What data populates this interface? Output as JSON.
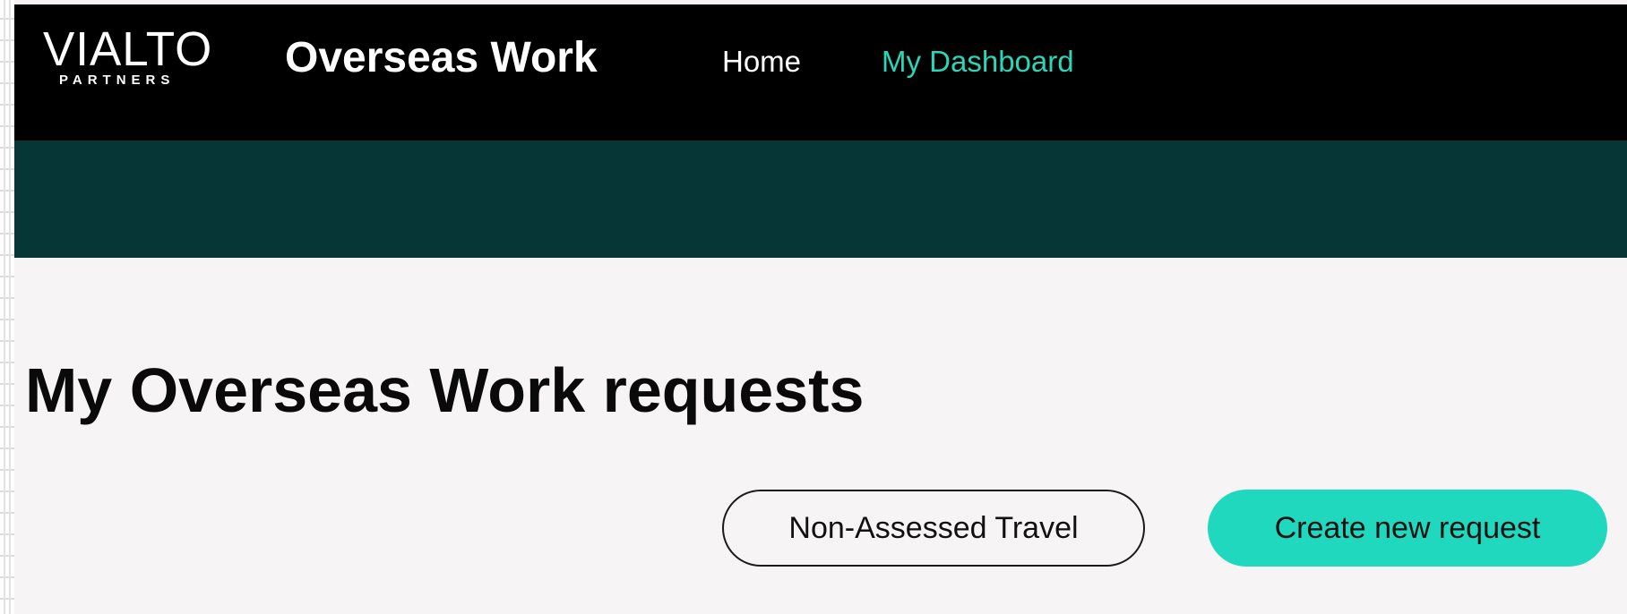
{
  "header": {
    "logo": {
      "main": "VIALTO",
      "sub": "PARTNERS"
    },
    "app_title": "Overseas Work",
    "nav": [
      {
        "label": "Home",
        "active": false
      },
      {
        "label": "My Dashboard",
        "active": true
      }
    ]
  },
  "main": {
    "page_title": "My Overseas Work requests",
    "buttons": {
      "non_assessed_travel": "Non-Assessed Travel",
      "create_new_request": "Create new request"
    }
  },
  "colors": {
    "header_bg": "#000000",
    "banner_bg": "#063636",
    "page_bg": "#f6f4f4",
    "accent": "#1fd8be",
    "nav_active": "#2ad6b8"
  }
}
